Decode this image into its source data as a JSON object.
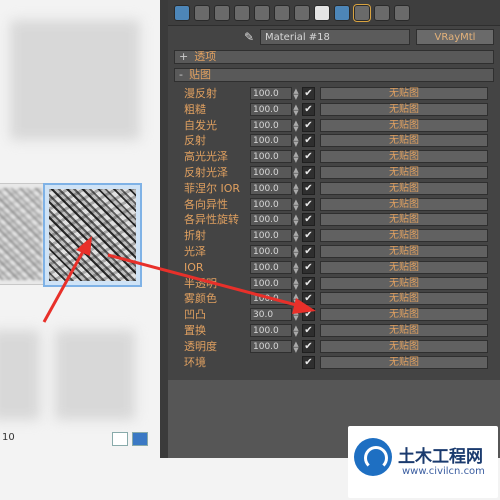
{
  "browser": {
    "status_text": "10"
  },
  "editor": {
    "material_name": "Material #18",
    "material_type": "VRayMtl",
    "rollouts": [
      {
        "sign": "+",
        "label": "透项"
      },
      {
        "sign": "-",
        "label": "贴图"
      }
    ],
    "maps": [
      {
        "label": "漫反射",
        "amount": "100.0",
        "checked": true,
        "slot": "无贴图"
      },
      {
        "label": "粗糙",
        "amount": "100.0",
        "checked": true,
        "slot": "无贴图"
      },
      {
        "label": "自发光",
        "amount": "100.0",
        "checked": true,
        "slot": "无贴图"
      },
      {
        "label": "反射",
        "amount": "100.0",
        "checked": true,
        "slot": "无贴图"
      },
      {
        "label": "高光光泽",
        "amount": "100.0",
        "checked": true,
        "slot": "无贴图"
      },
      {
        "label": "反射光泽",
        "amount": "100.0",
        "checked": true,
        "slot": "无贴图"
      },
      {
        "label": "菲涅尔 IOR",
        "amount": "100.0",
        "checked": true,
        "slot": "无贴图"
      },
      {
        "label": "各向异性",
        "amount": "100.0",
        "checked": true,
        "slot": "无贴图"
      },
      {
        "label": "各异性旋转",
        "amount": "100.0",
        "checked": true,
        "slot": "无贴图"
      },
      {
        "label": "折射",
        "amount": "100.0",
        "checked": true,
        "slot": "无贴图"
      },
      {
        "label": "光泽",
        "amount": "100.0",
        "checked": true,
        "slot": "无贴图"
      },
      {
        "label": "IOR",
        "amount": "100.0",
        "checked": true,
        "slot": "无贴图"
      },
      {
        "label": "半透明",
        "amount": "100.0",
        "checked": true,
        "slot": "无贴图"
      },
      {
        "label": "雾颜色",
        "amount": "100.0",
        "checked": true,
        "slot": "无贴图"
      },
      {
        "label": "凹凸",
        "amount": "30.0",
        "checked": true,
        "slot": "无贴图"
      },
      {
        "label": "置换",
        "amount": "100.0",
        "checked": true,
        "slot": "无贴图"
      },
      {
        "label": "透明度",
        "amount": "100.0",
        "checked": true,
        "slot": "无贴图"
      },
      {
        "label": "环境",
        "amount": "",
        "checked": true,
        "slot": "无贴图"
      }
    ]
  },
  "watermark": {
    "title": "土木工程网",
    "url": "www.civilcn.com"
  },
  "colors": {
    "arrow": "#e8302a",
    "label_orange": "#e0a060",
    "panel_bg": "#444444"
  }
}
